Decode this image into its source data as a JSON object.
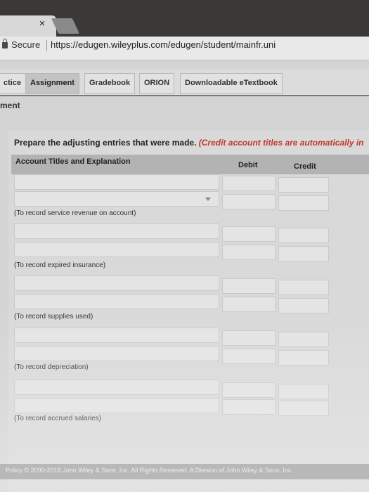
{
  "browser": {
    "tab_close": "×",
    "secure_label": "Secure",
    "url": "https://edugen.wileyplus.com/edugen/student/mainfr.uni"
  },
  "nav": {
    "tabs": [
      "ctice",
      "Assignment",
      "Gradebook",
      "ORION",
      "Downloadable eTextbook"
    ],
    "active": "Assignment"
  },
  "section_title": "ment",
  "instruction": {
    "text": "Prepare the adjusting entries that were made.",
    "red_text": "(Credit account titles are automatically in"
  },
  "table": {
    "headers": {
      "account": "Account Titles and Explanation",
      "debit": "Debit",
      "credit": "Credit"
    },
    "notes": [
      "(To record service revenue on account)",
      "(To record expired insurance)",
      "(To record supplies used)",
      "(To record depreciation)",
      "(To record accrued salaries)"
    ]
  },
  "footer": "Policy   © 2000-2018 John Wiley & Sons, Inc. All Rights Reserved. A Division of John Wiley & Sons, Inc.",
  "colors": {
    "instruction_red": "#c0392b",
    "page_bg": "#d4d4d4",
    "header_bg": "#b3b3b3"
  }
}
